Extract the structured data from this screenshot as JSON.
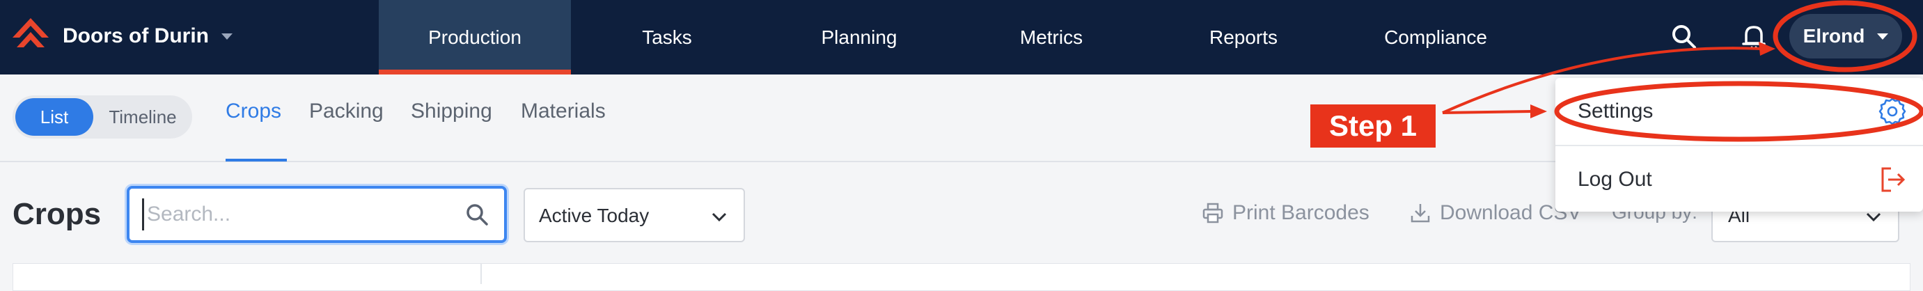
{
  "app": {
    "name": "Doors of Durin"
  },
  "nav": {
    "tabs": [
      {
        "label": "Production"
      },
      {
        "label": "Tasks"
      },
      {
        "label": "Planning"
      },
      {
        "label": "Metrics"
      },
      {
        "label": "Reports"
      },
      {
        "label": "Compliance"
      }
    ],
    "active_tab": "Production",
    "user": "Elrond"
  },
  "view_toggle": {
    "options": [
      "List",
      "Timeline"
    ],
    "selected": "List"
  },
  "subtabs": [
    {
      "label": "Crops"
    },
    {
      "label": "Packing"
    },
    {
      "label": "Shipping"
    },
    {
      "label": "Materials"
    }
  ],
  "page": {
    "title": "Crops",
    "search_placeholder": "Search...",
    "filter_value": "Active Today",
    "print_label": "Print Barcodes",
    "download_label": "Download CSV",
    "groupby_label": "Group by:",
    "groupby_value": "All"
  },
  "user_menu": {
    "items": [
      {
        "label": "Settings",
        "icon": "gear-icon"
      },
      {
        "label": "Log Out",
        "icon": "logout-icon"
      }
    ]
  },
  "annotation": {
    "label": "Step 1",
    "color": "#e8331b"
  },
  "colors": {
    "nav_bg": "#0e1f3d",
    "accent": "#2f7be5",
    "brand_red": "#e8452c"
  }
}
